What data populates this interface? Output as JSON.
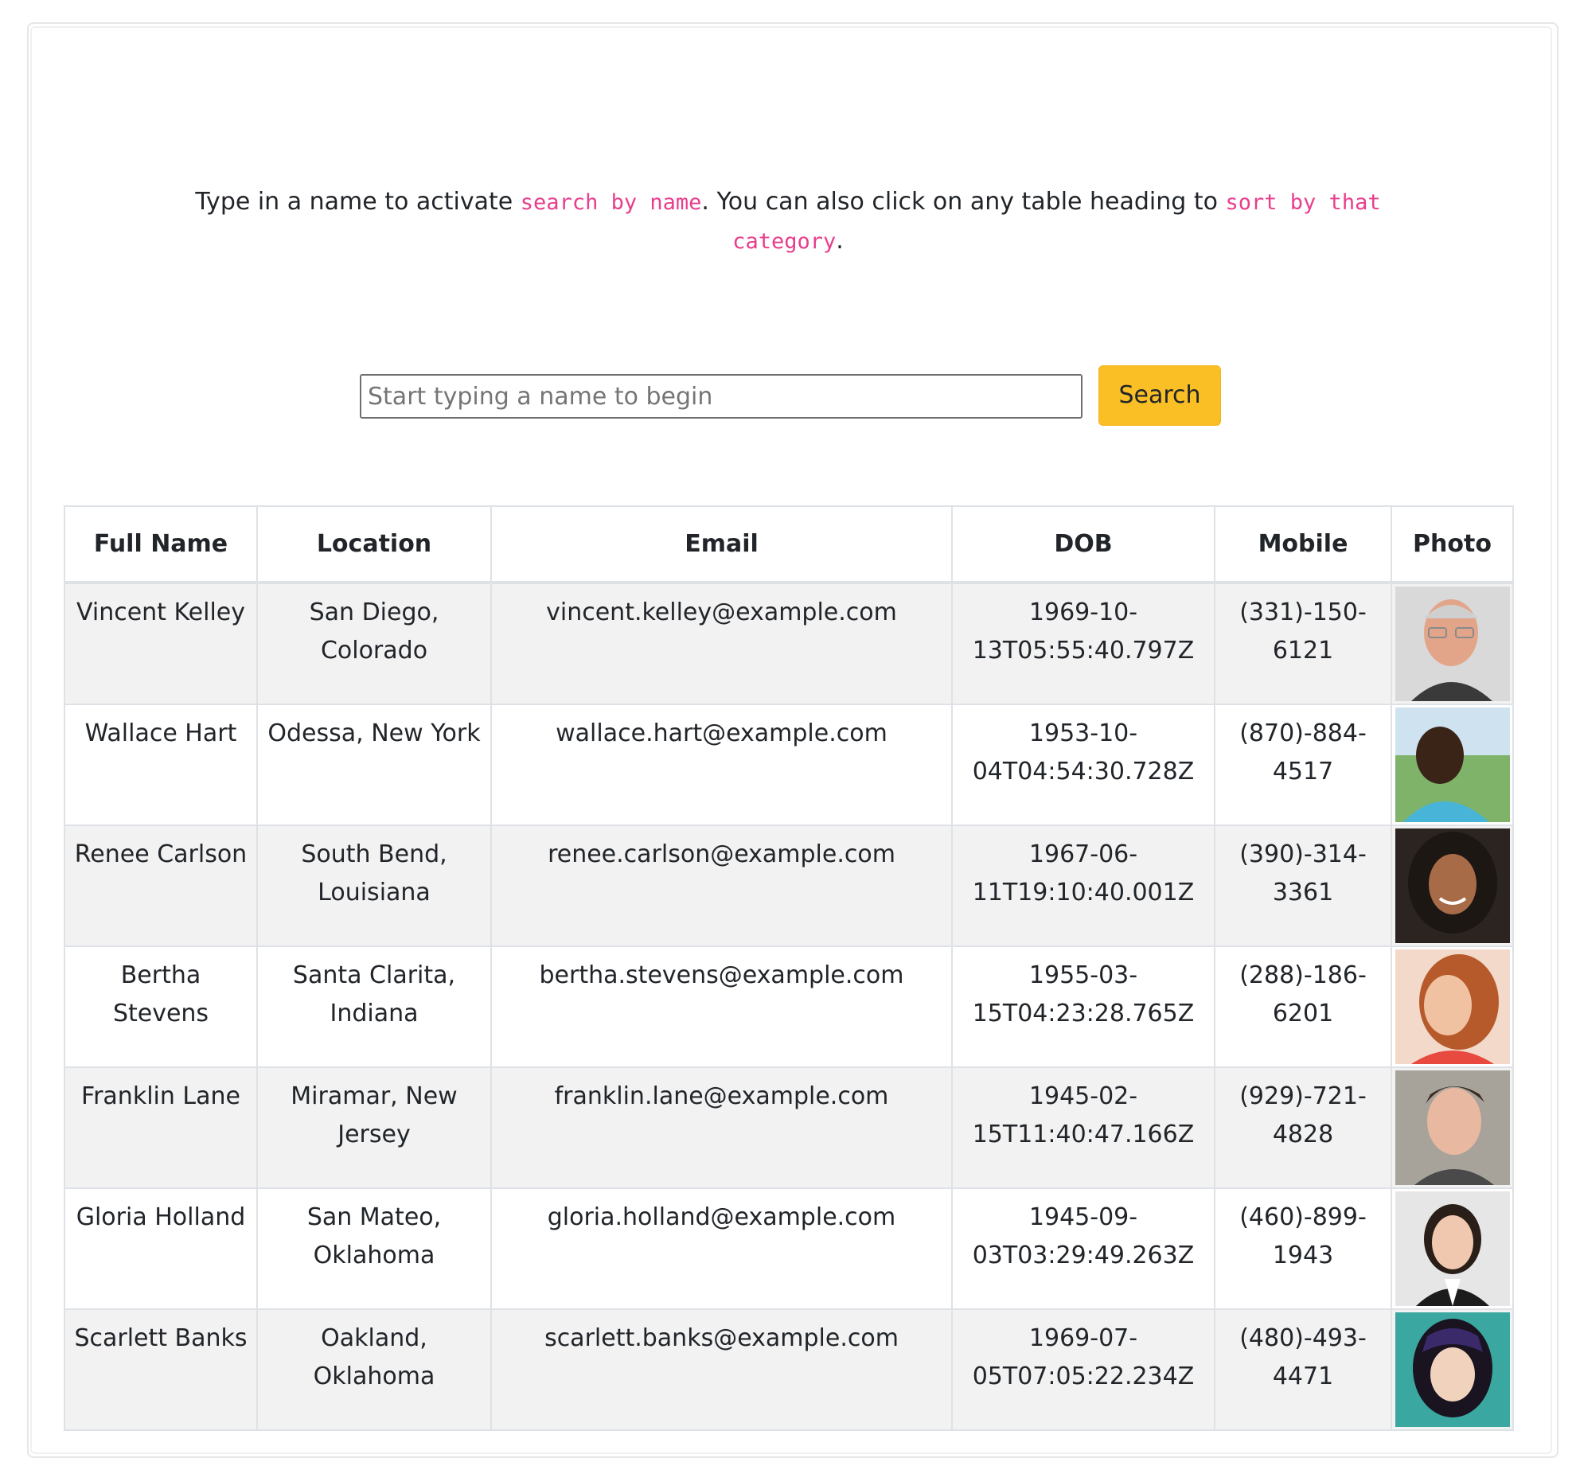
{
  "intro": {
    "text_before": "Type in a name to activate ",
    "code_search": "search by name",
    "text_middle": ". You can also click on any table heading to ",
    "code_sort": "sort by that category",
    "text_after": "."
  },
  "search": {
    "placeholder": "Start typing a name to begin",
    "button_label": "Search"
  },
  "table": {
    "headers": [
      "Full Name",
      "Location",
      "Email",
      "DOB",
      "Mobile",
      "Photo"
    ],
    "rows": [
      {
        "name": "Vincent Kelley",
        "location": "San Diego, Colorado",
        "email": "vincent.kelley@example.com",
        "dob": "1969-10-13T05:55:40.797Z",
        "mobile": "(331)-150-6121",
        "photo": "older-man-glasses-portrait"
      },
      {
        "name": "Wallace Hart",
        "location": "Odessa, New York",
        "email": "wallace.hart@example.com",
        "dob": "1953-10-04T04:54:30.728Z",
        "mobile": "(870)-884-4517",
        "photo": "young-man-outdoors-portrait"
      },
      {
        "name": "Renee Carlson",
        "location": "South Bend, Louisiana",
        "email": "renee.carlson@example.com",
        "dob": "1967-06-11T19:10:40.001Z",
        "mobile": "(390)-314-3361",
        "photo": "woman-curly-hair-portrait"
      },
      {
        "name": "Bertha Stevens",
        "location": "Santa Clarita, Indiana",
        "email": "bertha.stevens@example.com",
        "dob": "1955-03-15T04:23:28.765Z",
        "mobile": "(288)-186-6201",
        "photo": "woman-long-hair-portrait"
      },
      {
        "name": "Franklin Lane",
        "location": "Miramar, New Jersey",
        "email": "franklin.lane@example.com",
        "dob": "1945-02-15T11:40:47.166Z",
        "mobile": "(929)-721-4828",
        "photo": "young-man-portrait"
      },
      {
        "name": "Gloria Holland",
        "location": "San Mateo, Oklahoma",
        "email": "gloria.holland@example.com",
        "dob": "1945-09-03T03:29:49.263Z",
        "mobile": "(460)-899-1943",
        "photo": "woman-smiling-portrait"
      },
      {
        "name": "Scarlett Banks",
        "location": "Oakland, Oklahoma",
        "email": "scarlett.banks@example.com",
        "dob": "1969-07-05T07:05:22.234Z",
        "mobile": "(480)-493-4471",
        "photo": "woman-dark-hair-portrait"
      }
    ]
  },
  "colors": {
    "accent_button": "#fbbf26",
    "code_pink": "#e83e8c",
    "row_stripe": "#f2f2f2",
    "border": "#dee2e6"
  }
}
